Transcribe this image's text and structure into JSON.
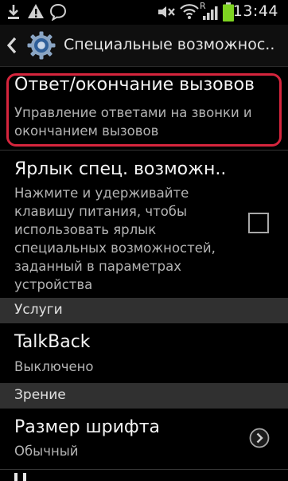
{
  "status_bar": {
    "time": "13:44",
    "network_type": "R",
    "icons": [
      "download-icon",
      "warning-icon",
      "speech-bubble-icon",
      "mute-icon",
      "wifi-icon",
      "signal-icon",
      "battery-icon"
    ]
  },
  "action_bar": {
    "title": "Специальные возможнос..",
    "back_icon": "chevron-left-icon",
    "app_icon": "gear-icon"
  },
  "items": [
    {
      "title": "Ответ/окончание вызовов",
      "subtitle_lines": [
        "Управление ответами на звонки и",
        "окончанием вызовов"
      ],
      "highlighted": true
    },
    {
      "title": "Ярлык спец. возможн..",
      "subtitle_lines": [
        "Нажмите и удерживайте",
        "клавишу питания, чтобы",
        "использовать ярлык",
        "специальных возможностей,",
        "заданный в параметрах",
        "устройства"
      ],
      "checkbox_checked": false
    }
  ],
  "sections": [
    {
      "header": "Услуги",
      "items": [
        {
          "title": "TalkBack",
          "subtitle": "Выключено"
        }
      ]
    },
    {
      "header": "Зрение",
      "items": [
        {
          "title": "Размер шрифта",
          "subtitle": "Обычный",
          "accessory": "chevron-right-circle-icon"
        }
      ]
    }
  ],
  "colors": {
    "highlight": "#d6253d",
    "battery": "#7ed321",
    "section_background": "#303030"
  }
}
